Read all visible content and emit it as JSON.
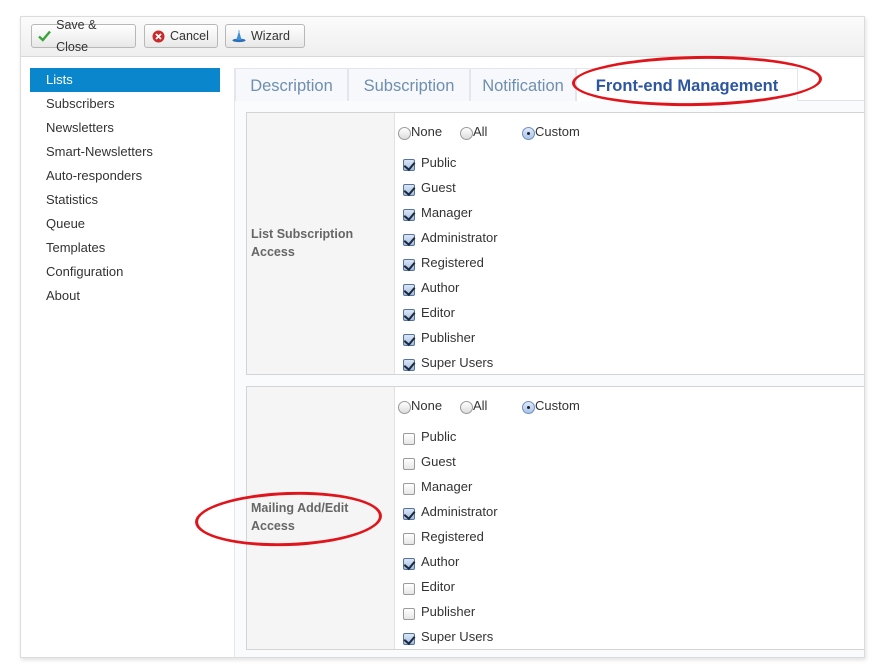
{
  "toolbar": {
    "save_close": "Save & Close",
    "cancel": "Cancel",
    "wizard": "Wizard",
    "icons": {
      "save": "check-icon",
      "cancel": "cancel-circle-icon",
      "wizard": "wizard-hat-icon"
    }
  },
  "sidebar": {
    "items": [
      {
        "label": "Lists",
        "active": true
      },
      {
        "label": "Subscribers"
      },
      {
        "label": "Newsletters"
      },
      {
        "label": "Smart-Newsletters"
      },
      {
        "label": "Auto-responders"
      },
      {
        "label": "Statistics"
      },
      {
        "label": "Queue"
      },
      {
        "label": "Templates"
      },
      {
        "label": "Configuration"
      },
      {
        "label": "About"
      }
    ]
  },
  "tabs": [
    {
      "label": "Description"
    },
    {
      "label": "Subscription"
    },
    {
      "label": "Notification"
    },
    {
      "label": "Front-end Management",
      "active": true
    }
  ],
  "sections": [
    {
      "label": "List Subscription Access",
      "radios": [
        {
          "label": "None",
          "selected": false
        },
        {
          "label": "All",
          "selected": false
        },
        {
          "label": "Custom",
          "selected": true
        }
      ],
      "checkboxes": [
        {
          "label": "Public",
          "checked": true
        },
        {
          "label": "Guest",
          "checked": true
        },
        {
          "label": "Manager",
          "checked": true
        },
        {
          "label": "Administrator",
          "checked": true
        },
        {
          "label": "Registered",
          "checked": true
        },
        {
          "label": "Author",
          "checked": true
        },
        {
          "label": "Editor",
          "checked": true
        },
        {
          "label": "Publisher",
          "checked": true
        },
        {
          "label": "Super Users",
          "checked": true
        }
      ]
    },
    {
      "label": "Mailing Add/Edit Access",
      "radios": [
        {
          "label": "None",
          "selected": false
        },
        {
          "label": "All",
          "selected": false
        },
        {
          "label": "Custom",
          "selected": true
        }
      ],
      "checkboxes": [
        {
          "label": "Public",
          "checked": false
        },
        {
          "label": "Guest",
          "checked": false
        },
        {
          "label": "Manager",
          "checked": false
        },
        {
          "label": "Administrator",
          "checked": true
        },
        {
          "label": "Registered",
          "checked": false
        },
        {
          "label": "Author",
          "checked": true
        },
        {
          "label": "Editor",
          "checked": false
        },
        {
          "label": "Publisher",
          "checked": false
        },
        {
          "label": "Super Users",
          "checked": true
        }
      ]
    }
  ],
  "colors": {
    "accent": "#0a87cc",
    "active_tab_text": "#2c56a0",
    "annotation": "#e0141b"
  }
}
